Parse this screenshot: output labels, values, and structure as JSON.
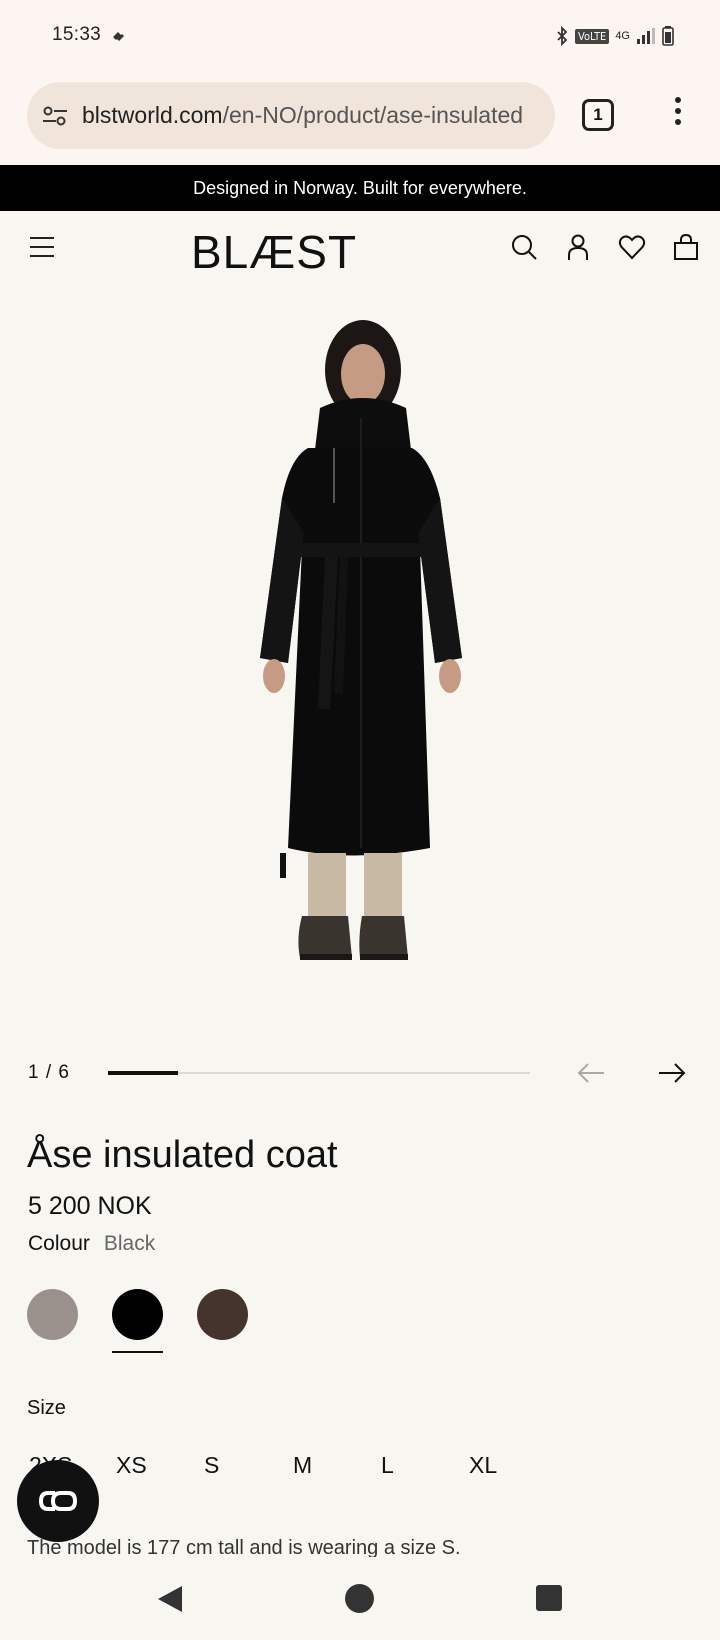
{
  "status_bar": {
    "time": "15:33",
    "icons": [
      "bluetooth-icon",
      "volte-badge",
      "signal-icon",
      "battery-icon"
    ],
    "volte_label": "VoLTE",
    "network_label": "4G"
  },
  "browser": {
    "url_host": "blstworld.com",
    "url_path": "/en-NO/product/ase-insulated",
    "tab_count": "1"
  },
  "announcement": "Designed in Norway. Built for everywhere.",
  "header": {
    "logo": "BLÆST",
    "icons": [
      "menu-icon",
      "search-icon",
      "account-icon",
      "wishlist-icon",
      "bag-icon"
    ]
  },
  "gallery": {
    "counter": "1 / 6",
    "current": 1,
    "total": 6,
    "progress_fraction": 0.167
  },
  "product": {
    "title": "Åse insulated coat",
    "price": "5 200 NOK",
    "colour_label": "Colour",
    "colour_value": "Black",
    "swatches": [
      {
        "name": "Grey",
        "hex": "#9b918c",
        "selected": false
      },
      {
        "name": "Black",
        "hex": "#000000",
        "selected": true
      },
      {
        "name": "Brown",
        "hex": "#45332e",
        "selected": false
      }
    ],
    "size_label": "Size",
    "sizes": [
      "2XS",
      "XS",
      "S",
      "M",
      "L",
      "XL"
    ],
    "model_note": "The model is 177 cm tall and is wearing a size S."
  },
  "colors": {
    "background": "#f7f6f1",
    "browser_chrome": "#fdf5f1",
    "url_pill": "#f1e4db",
    "announcement_bg": "#000000"
  }
}
